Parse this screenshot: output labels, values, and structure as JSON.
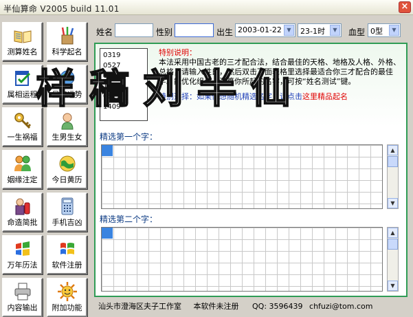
{
  "window": {
    "title": "半仙算命 V2005 build 11.01",
    "close_label": "×"
  },
  "sidebar": {
    "items": [
      {
        "label": "测算姓名",
        "icon": "open-book-icon"
      },
      {
        "label": "科学起名",
        "icon": "brushes-icon"
      },
      {
        "label": "属相运程",
        "icon": "calendar-check-icon"
      },
      {
        "label": "星座运势",
        "icon": "globe-icon"
      },
      {
        "label": "一生祸福",
        "icon": "key-icon"
      },
      {
        "label": "生男生女",
        "icon": "baby-icon"
      },
      {
        "label": "姻缘注定",
        "icon": "couple-icon"
      },
      {
        "label": "今日黄历",
        "icon": "earth-icon"
      },
      {
        "label": "命造简批",
        "icon": "person-key-icon"
      },
      {
        "label": "手机吉凶",
        "icon": "calculator-icon"
      },
      {
        "label": "万年历法",
        "icon": "windows-flag-icon"
      },
      {
        "label": "软件注册",
        "icon": "windows-logo-icon"
      },
      {
        "label": "内容输出",
        "icon": "printer-icon"
      },
      {
        "label": "附加功能",
        "icon": "sun-icon"
      }
    ]
  },
  "form": {
    "name_label": "姓名",
    "name_value": "",
    "gender_label": "性别",
    "gender_value": "",
    "birth_label": "出生",
    "date_value": "2003-01-22",
    "hour_value": "23-1时",
    "blood_label": "血型",
    "blood_value": "0型"
  },
  "codes": [
    "0319",
    "0527",
    "1121",
    "1324",
    "0611",
    "1409"
  ],
  "description": {
    "heading": "特别说明：",
    "body": "本法采用中国古老的三才配合法，结合最佳的天格、地格及人格、外格、总格，请输入姓氏，然后双击下面表格里选择最适合你三才配合的最佳字。能优化组合，测算你所起的名字，可按“姓名测试”键。",
    "hint_blue": "特别选择：如果你想随机精选名字，请点击",
    "hint_red": "这里精品起名"
  },
  "watermark": {
    "text": "样  稿  刘  半  仙"
  },
  "sections": {
    "first": "精选第一个字：",
    "second": "精选第二个字："
  },
  "status": {
    "company": "汕头市澄海区夫子工作室",
    "reg": "本软件未注册",
    "qq": "QQ: 3596439",
    "email": "chfuzi@tom.com"
  },
  "colors": {
    "accent_green": "#2f9c55",
    "select_blue": "#3a84e0",
    "heading_red": "#e00000",
    "hint_blue": "#1f3fb8"
  }
}
